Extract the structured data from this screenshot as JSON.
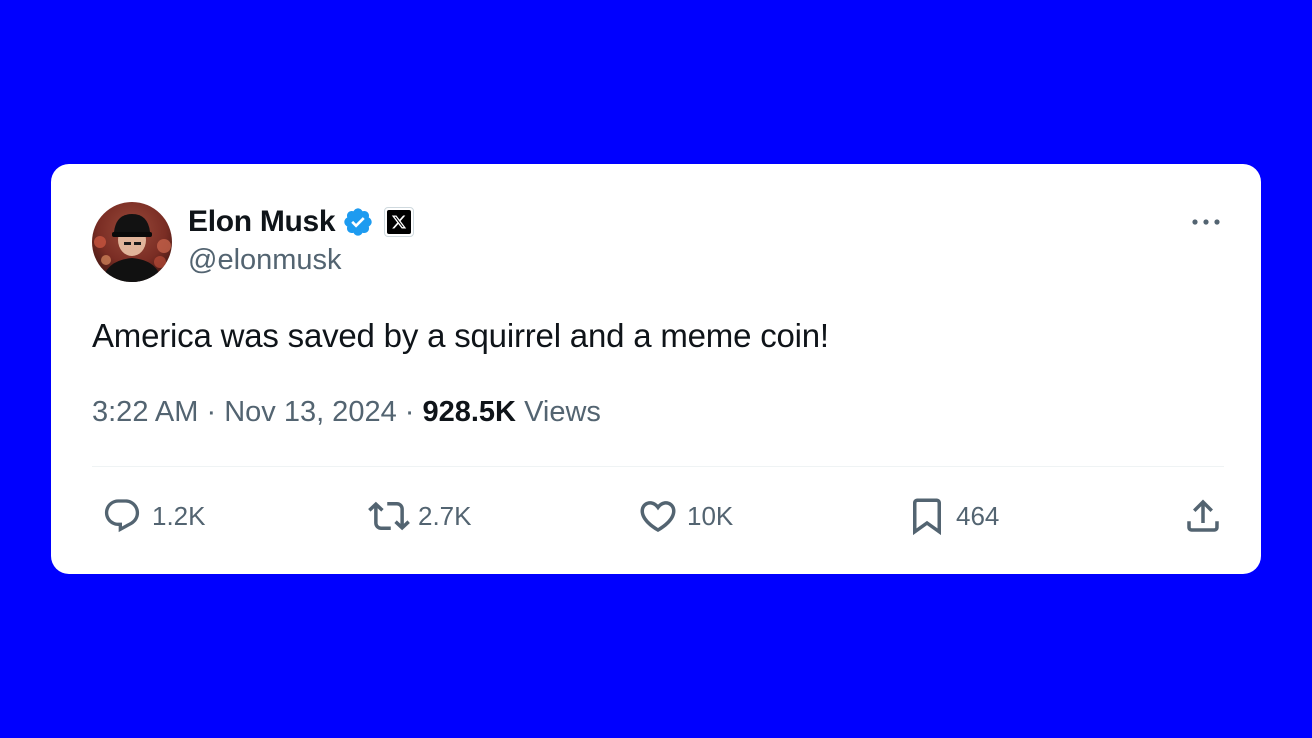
{
  "tweet": {
    "author": {
      "name": "Elon Musk",
      "handle": "@elonmusk",
      "verified": true,
      "affiliation_badge": "x-logo-icon"
    },
    "text": "America was saved by a squirrel and a meme coin!",
    "time": "3:22 AM",
    "date": "Nov 13, 2024",
    "separator": " · ",
    "views_count": "928.5K",
    "views_label": "Views",
    "actions": {
      "reply_count": "1.2K",
      "retweet_count": "2.7K",
      "like_count": "10K",
      "bookmark_count": "464"
    }
  },
  "colors": {
    "background": "#0000FF",
    "card": "#FFFFFF",
    "verified_blue": "#1D9BF0",
    "text_primary": "#0F1419",
    "text_secondary": "#536471"
  },
  "icons": {
    "more": "more-horizontal-icon",
    "reply": "reply-bubble-icon",
    "retweet": "retweet-icon",
    "like": "heart-icon",
    "bookmark": "bookmark-icon",
    "share": "share-upload-icon"
  }
}
